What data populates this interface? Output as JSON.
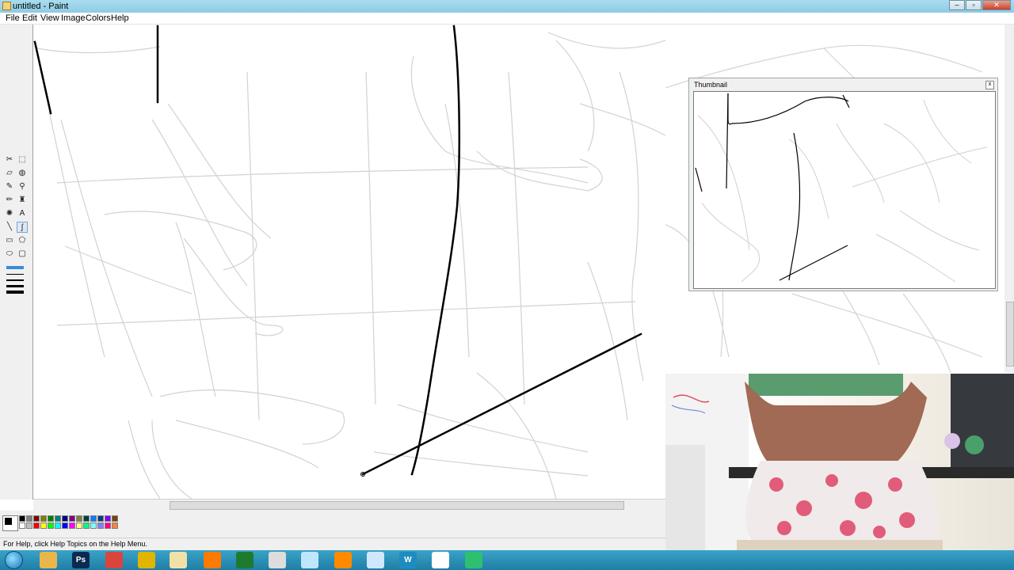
{
  "window": {
    "title": "untitled - Paint"
  },
  "menu": [
    "File",
    "Edit",
    "View",
    "Image",
    "Colors",
    "Help"
  ],
  "tools": [
    {
      "name": "free-form-select-icon",
      "glyph": "✂"
    },
    {
      "name": "select-icon",
      "glyph": "⬚"
    },
    {
      "name": "eraser-icon",
      "glyph": "▱"
    },
    {
      "name": "fill-icon",
      "glyph": "◍"
    },
    {
      "name": "color-picker-icon",
      "glyph": "✎"
    },
    {
      "name": "magnifier-icon",
      "glyph": "⚲"
    },
    {
      "name": "pencil-icon",
      "glyph": "✏"
    },
    {
      "name": "brush-icon",
      "glyph": "♜"
    },
    {
      "name": "airbrush-icon",
      "glyph": "✺"
    },
    {
      "name": "text-icon",
      "glyph": "A"
    },
    {
      "name": "line-icon",
      "glyph": "╲"
    },
    {
      "name": "curve-icon",
      "glyph": "∫"
    },
    {
      "name": "rectangle-icon",
      "glyph": "▭"
    },
    {
      "name": "polygon-icon",
      "glyph": "⬠"
    },
    {
      "name": "ellipse-icon",
      "glyph": "⬭"
    },
    {
      "name": "rounded-rectangle-icon",
      "glyph": "▢"
    }
  ],
  "palette": [
    "#000000",
    "#808080",
    "#800000",
    "#808000",
    "#008000",
    "#008080",
    "#000080",
    "#800080",
    "#808040",
    "#004040",
    "#0080ff",
    "#004080",
    "#8000ff",
    "#804000",
    "#ffffff",
    "#c0c0c0",
    "#ff0000",
    "#ffff00",
    "#00ff00",
    "#00ffff",
    "#0000ff",
    "#ff00ff",
    "#ffff80",
    "#00ff80",
    "#80ffff",
    "#8080ff",
    "#ff0080",
    "#ff8040"
  ],
  "thumbnail": {
    "title": "Thumbnail",
    "close": "x"
  },
  "status": {
    "text": "For Help, click Help Topics on the Help Menu."
  },
  "taskbar": [
    {
      "name": "explorer-taskbar-icon",
      "color": "#e8b64b",
      "glyph": ""
    },
    {
      "name": "photoshop-taskbar-icon",
      "color": "#0b2a4f",
      "glyph": "Ps"
    },
    {
      "name": "chrome-taskbar-icon",
      "color": "#d9453b",
      "glyph": ""
    },
    {
      "name": "app-taskbar-icon-1",
      "color": "#e0b400",
      "glyph": ""
    },
    {
      "name": "paint-taskbar-icon",
      "color": "#f2e1a7",
      "glyph": ""
    },
    {
      "name": "media-taskbar-icon",
      "color": "#ff7a00",
      "glyph": ""
    },
    {
      "name": "excel-taskbar-icon",
      "color": "#1e7a2e",
      "glyph": ""
    },
    {
      "name": "app-taskbar-icon-2",
      "color": "#dddddd",
      "glyph": ""
    },
    {
      "name": "notepad-taskbar-icon",
      "color": "#bfe6ff",
      "glyph": ""
    },
    {
      "name": "blender-taskbar-icon",
      "color": "#ff8a00",
      "glyph": ""
    },
    {
      "name": "app-taskbar-icon-3",
      "color": "#cfe8ff",
      "glyph": ""
    },
    {
      "name": "wordpress-taskbar-icon",
      "color": "#1e8cbe",
      "glyph": "W"
    },
    {
      "name": "app-taskbar-icon-4",
      "color": "#ffffff",
      "glyph": ""
    },
    {
      "name": "app-taskbar-icon-5",
      "color": "#2fbf71",
      "glyph": ""
    }
  ]
}
